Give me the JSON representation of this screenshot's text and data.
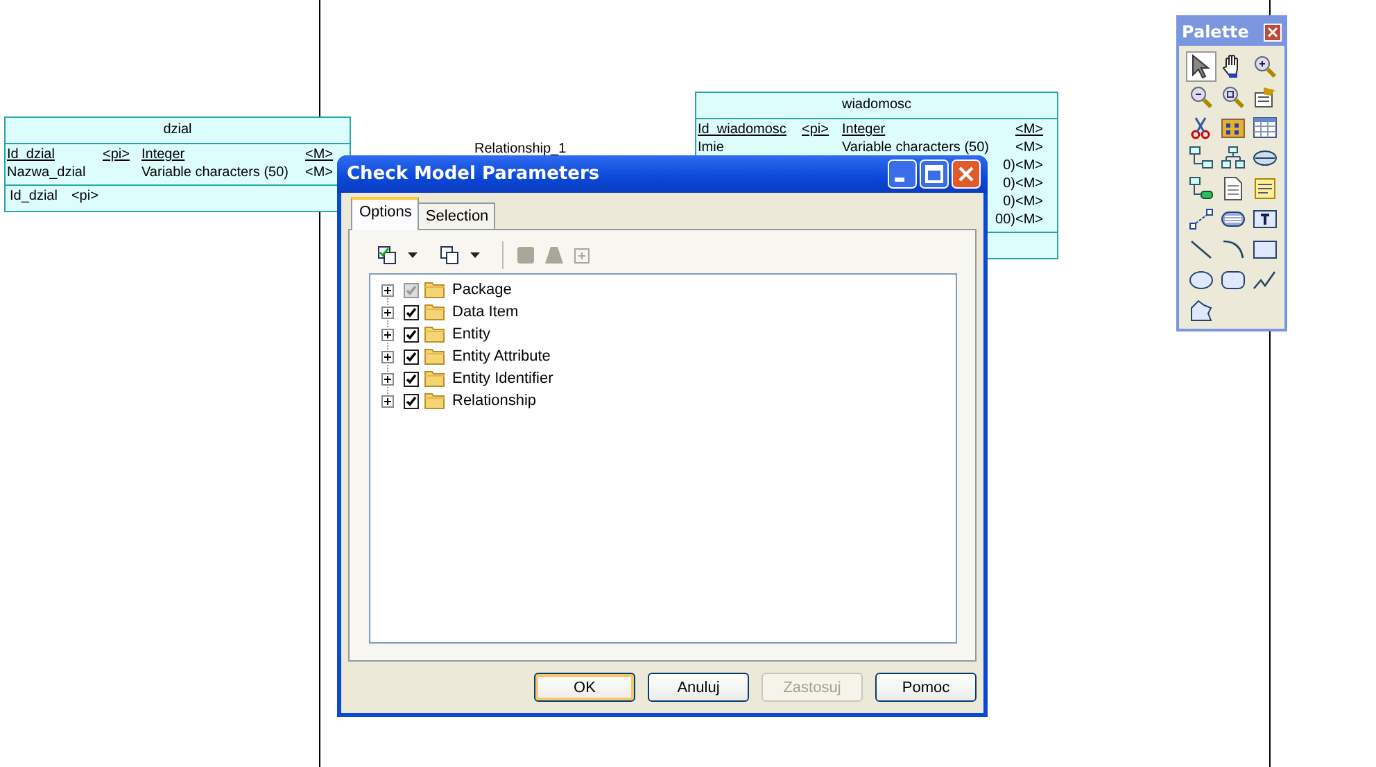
{
  "canvas": {
    "entities": [
      {
        "title": "dzial",
        "attributes": [
          {
            "kind": "full",
            "name": "Id_dzial",
            "pi": "<pi>",
            "type": "Integer",
            "mandatory": "<M>",
            "primary": true
          },
          {
            "kind": "full",
            "name": "Nazwa_dzial",
            "type": "Variable characters (50)",
            "mandatory": "<M>",
            "primary": false
          }
        ],
        "identifiers": [
          {
            "name": "Id_dzial",
            "pi": "<pi>"
          }
        ]
      },
      {
        "title": "wiadomosc",
        "attributes": [
          {
            "kind": "full",
            "name": "Id_wiadomosc",
            "pi": "<pi>",
            "type": "Integer",
            "mandatory": "<M>",
            "primary": true
          },
          {
            "kind": "full",
            "name": "Imie",
            "type": "Variable characters (50)",
            "mandatory": "<M>",
            "primary": false
          },
          {
            "kind": "partial",
            "type": "0)",
            "mandatory": "<M>",
            "primary": false
          },
          {
            "kind": "partial",
            "type": "0)",
            "mandatory": "<M>",
            "primary": false
          },
          {
            "kind": "partial",
            "type": "0)",
            "mandatory": "<M>",
            "primary": false
          },
          {
            "kind": "partial",
            "type": "00)",
            "mandatory": "<M>",
            "primary": false
          }
        ]
      }
    ],
    "relationship_label": "Relationship_1"
  },
  "palette": {
    "title": "Palette",
    "close": "×",
    "tools": [
      {
        "selected": true
      },
      {
        "selected": false
      },
      {
        "selected": false
      },
      {
        "selected": false
      },
      {
        "selected": false
      },
      {
        "selected": false
      },
      {
        "selected": false
      },
      {
        "selected": false
      },
      {
        "selected": false
      },
      {
        "selected": false
      },
      {
        "selected": false
      },
      {
        "selected": false
      },
      {
        "selected": false
      },
      {
        "selected": false
      },
      {
        "selected": false
      },
      {
        "selected": false
      },
      {
        "selected": false
      },
      {
        "selected": false
      },
      {
        "selected": false
      },
      {
        "selected": false
      },
      {
        "selected": false
      },
      {
        "selected": false
      },
      {
        "selected": false
      },
      {
        "selected": false
      },
      {
        "selected": false
      }
    ]
  },
  "dialog": {
    "title": "Check Model Parameters",
    "tabs": [
      {
        "label": "Options",
        "selected": true
      },
      {
        "label": "Selection",
        "selected": false
      }
    ],
    "tree": [
      {
        "label": "Package",
        "checked": true,
        "mixed": true,
        "expanded": false
      },
      {
        "label": "Data Item",
        "checked": true,
        "mixed": false,
        "expanded": false
      },
      {
        "label": "Entity",
        "checked": true,
        "mixed": false,
        "expanded": false
      },
      {
        "label": "Entity Attribute",
        "checked": true,
        "mixed": false,
        "expanded": false
      },
      {
        "label": "Entity Identifier",
        "checked": true,
        "mixed": false,
        "expanded": false
      },
      {
        "label": "Relationship",
        "checked": true,
        "mixed": false,
        "expanded": false
      }
    ],
    "buttons": [
      {
        "label": "OK",
        "default": true,
        "disabled": false
      },
      {
        "label": "Anuluj",
        "default": false,
        "disabled": false
      },
      {
        "label": "Zastosuj",
        "default": false,
        "disabled": true
      },
      {
        "label": "Pomoc",
        "default": false,
        "disabled": false
      }
    ]
  }
}
